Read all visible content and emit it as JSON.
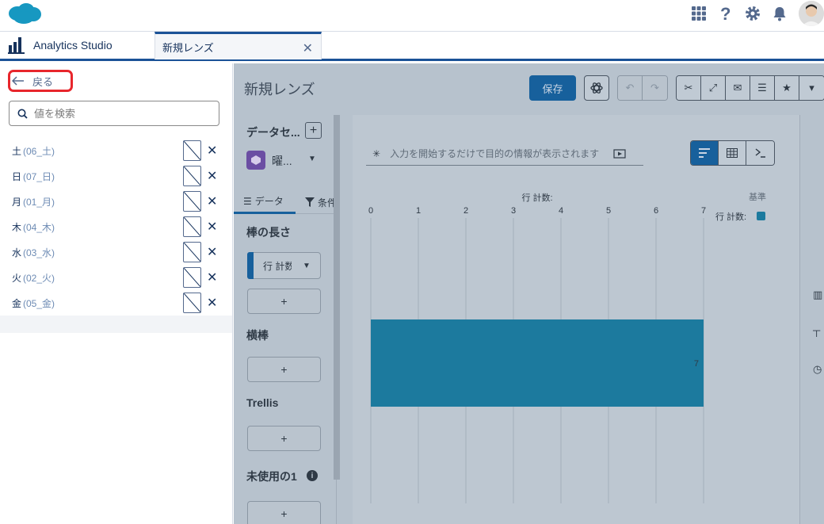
{
  "header": {
    "icons": [
      "waffle-icon",
      "help-icon",
      "gear-icon",
      "bell-icon"
    ]
  },
  "app": {
    "name": "Analytics Studio",
    "tab_label": "新規レンズ"
  },
  "left_panel": {
    "back_label": "戻る",
    "search_placeholder": "値を検索",
    "values": [
      {
        "label": "土",
        "key": "(06_土)"
      },
      {
        "label": "日",
        "key": "(07_日)"
      },
      {
        "label": "月",
        "key": "(01_月)"
      },
      {
        "label": "木",
        "key": "(04_木)"
      },
      {
        "label": "水",
        "key": "(03_水)"
      },
      {
        "label": "火",
        "key": "(02_火)"
      },
      {
        "label": "金",
        "key": "(05_金)"
      }
    ]
  },
  "lens": {
    "title": "新規レンズ",
    "save_label": "保存"
  },
  "config": {
    "dataset_title": "データセ...",
    "dataset_name": "曜...",
    "tab_data": "データ",
    "tab_filter": "条件",
    "bar_length_label": "棒の長さ",
    "measure_label": "行 計数",
    "bars_label": "横棒",
    "trellis_label": "Trellis",
    "unused_label": "未使用の1",
    "add_symbol": "+"
  },
  "canvas": {
    "query_placeholder": "入力を開始するだけで目的の情報が表示されます"
  },
  "colors": {
    "accent": "#17609c",
    "bar": "#1c7a9e",
    "highlight": "#e8262c"
  },
  "chart_data": {
    "type": "bar",
    "orientation": "horizontal",
    "title": "",
    "xlabel": "行 計数:",
    "ylabel": "",
    "xlim": [
      0,
      7
    ],
    "ticks": [
      "0",
      "1",
      "2",
      "3",
      "4",
      "5",
      "6",
      "7"
    ],
    "categories": [
      ""
    ],
    "series": [
      {
        "name": "行 計数:",
        "values": [
          7
        ]
      }
    ],
    "data_labels": [
      "7"
    ],
    "legend": {
      "title": "基準",
      "entries": [
        "行 計数:"
      ],
      "position": "top-right"
    },
    "grid": true
  }
}
